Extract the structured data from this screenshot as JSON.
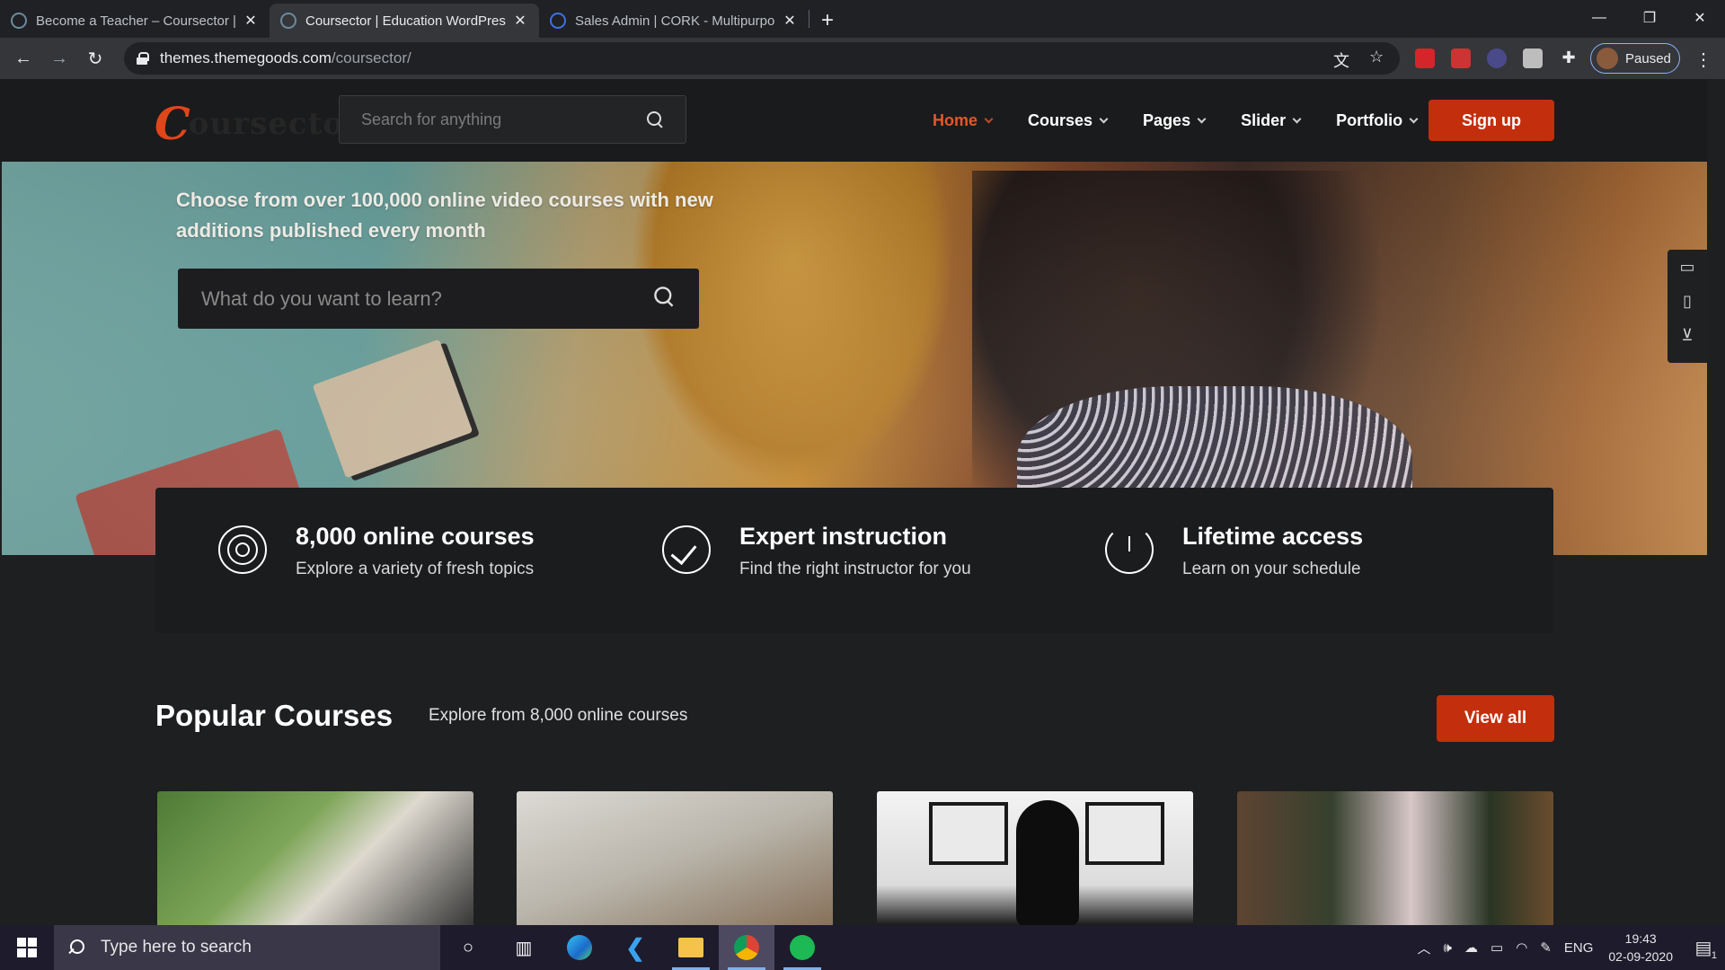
{
  "browser": {
    "tabs": [
      {
        "title": "Become a Teacher – Coursector |",
        "active": false
      },
      {
        "title": "Coursector | Education WordPres",
        "active": true
      },
      {
        "title": "Sales Admin | CORK - Multipurpo",
        "active": false
      }
    ],
    "url_host": "themes.themegoods.com",
    "url_path": "/coursector/",
    "profile_status": "Paused"
  },
  "site": {
    "logo_initial": "C",
    "logo_text": "oursector",
    "header_search_placeholder": "Search for anything",
    "nav": [
      {
        "label": "Home",
        "active": true
      },
      {
        "label": "Courses",
        "active": false
      },
      {
        "label": "Pages",
        "active": false
      },
      {
        "label": "Slider",
        "active": false
      },
      {
        "label": "Portfolio",
        "active": false
      }
    ],
    "signup_label": "Sign up",
    "accent_color": "#c32f0d",
    "hero": {
      "tagline": "Choose from over 100,000 online video courses with new additions published every month",
      "search_placeholder": "What do you want to learn?"
    },
    "features": [
      {
        "icon": "target-icon",
        "title": "8,000 online courses",
        "subtitle": "Explore a variety of fresh topics"
      },
      {
        "icon": "checkmark-circle-icon",
        "title": "Expert instruction",
        "subtitle": "Find the right instructor for you"
      },
      {
        "icon": "clock-history-icon",
        "title": "Lifetime access",
        "subtitle": "Learn on your schedule"
      }
    ],
    "popular": {
      "title": "Popular Courses",
      "subtitle": "Explore from 8,000 online courses",
      "view_all_label": "View all"
    },
    "side_dock_icons": [
      "chat-icon",
      "book-icon",
      "cart-icon"
    ]
  },
  "taskbar": {
    "search_placeholder": "Type here to search",
    "language": "ENG",
    "time": "19:43",
    "date": "02-09-2020",
    "notification_count": "1"
  }
}
